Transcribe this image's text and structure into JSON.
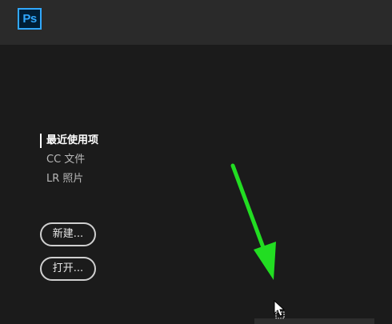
{
  "app": {
    "logo_text": "Ps",
    "brand_color": "#31a8ff",
    "logo_bg": "#001e36"
  },
  "sidebar": {
    "items": [
      {
        "label": "最近使用项",
        "active": true
      },
      {
        "label": "CC 文件",
        "active": false
      },
      {
        "label": "LR 照片",
        "active": false
      }
    ]
  },
  "actions": {
    "new_label": "新建...",
    "open_label": "打开..."
  },
  "annotation": {
    "arrow_color": "#22dd22",
    "arrow_icon": "green-arrow-icon",
    "cursor_icon": "mouse-cursor-icon"
  }
}
